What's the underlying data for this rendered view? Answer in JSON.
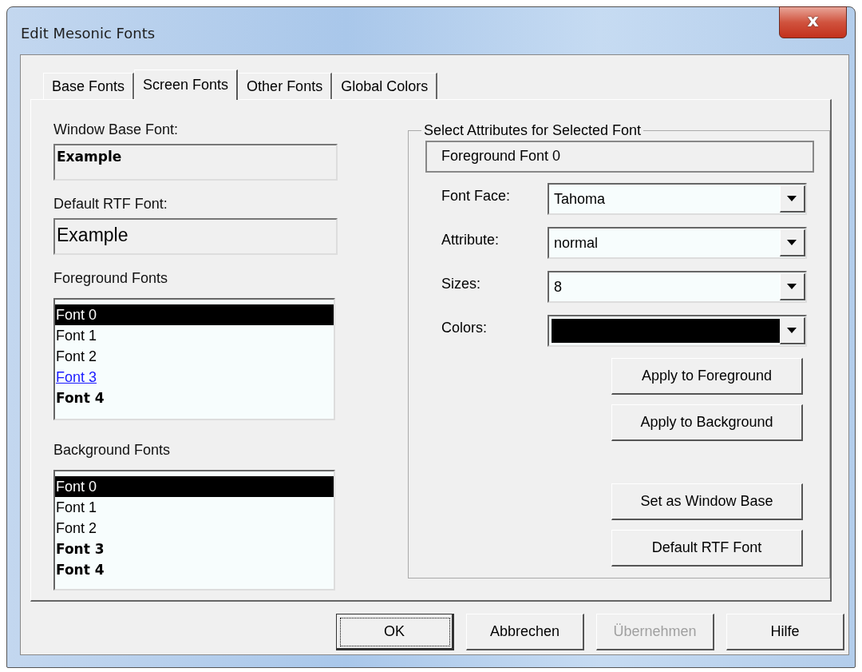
{
  "window": {
    "title": "Edit Mesonic Fonts",
    "close": "x"
  },
  "tabs": [
    {
      "label": "Base Fonts",
      "selected": false
    },
    {
      "label": "Screen Fonts",
      "selected": true
    },
    {
      "label": "Other Fonts",
      "selected": false
    },
    {
      "label": "Global Colors",
      "selected": false
    }
  ],
  "left": {
    "base_font": {
      "label": "Window Base Font:",
      "value": "Example",
      "kind": "bold"
    },
    "rtf_font": {
      "label": "Default RTF Font:",
      "value": "Example",
      "kind": "large"
    },
    "foreground": {
      "label": "Foreground Fonts",
      "items": [
        {
          "text": "Font 0",
          "selected": true,
          "kind": "normal"
        },
        {
          "text": "Font 1",
          "selected": false,
          "kind": "normal"
        },
        {
          "text": "Font 2",
          "selected": false,
          "kind": "normal"
        },
        {
          "text": "Font 3",
          "selected": false,
          "kind": "link"
        },
        {
          "text": "Font 4",
          "selected": false,
          "kind": "bold"
        }
      ]
    },
    "background": {
      "label": "Background Fonts",
      "items": [
        {
          "text": "Font 0",
          "selected": true,
          "kind": "normal"
        },
        {
          "text": "Font 1",
          "selected": false,
          "kind": "normal"
        },
        {
          "text": "Font 2",
          "selected": false,
          "kind": "normal"
        },
        {
          "text": "Font 3",
          "selected": false,
          "kind": "bold"
        },
        {
          "text": "Font 4",
          "selected": false,
          "kind": "bold"
        }
      ]
    }
  },
  "attributes": {
    "legend": "Select Attributes for Selected Font",
    "current": "Foreground Font 0",
    "fields": [
      {
        "label": "Font Face:",
        "value": "Tahoma",
        "kind": "text"
      },
      {
        "label": "Attribute:",
        "value": "normal",
        "kind": "text"
      },
      {
        "label": "Sizes:",
        "value": "8",
        "kind": "text"
      },
      {
        "label": "Colors:",
        "kind": "color",
        "color": "#000000"
      }
    ],
    "buttons": [
      "Apply to Foreground",
      "Apply to Background",
      "Set as Window Base",
      "Default RTF Font"
    ]
  },
  "buttons": [
    {
      "label": "OK",
      "focused": true,
      "disabled": false
    },
    {
      "label": "Abbrechen",
      "focused": false,
      "disabled": false
    },
    {
      "label": "Übernehmen",
      "focused": false,
      "disabled": true
    },
    {
      "label": "Hilfe",
      "focused": false,
      "disabled": false
    }
  ]
}
